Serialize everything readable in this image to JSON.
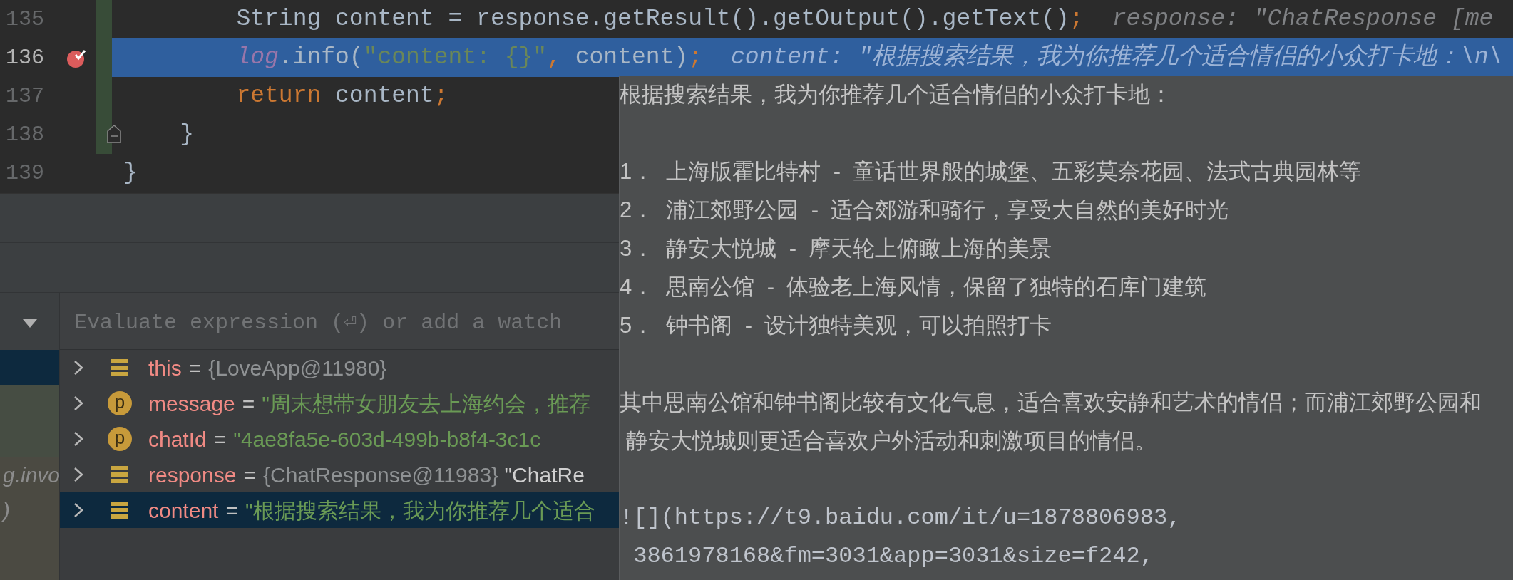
{
  "editor": {
    "lines": [
      {
        "number": "135",
        "breakpoint": false,
        "current": false,
        "changed": true,
        "fold_marker": false,
        "tokens": [
          {
            "kind": "plain",
            "text": "        String content = response.getResult().getOutput().getText()"
          },
          {
            "kind": "keyword",
            "text": ";"
          }
        ],
        "hint": "response: \"ChatResponse [me"
      },
      {
        "number": "136",
        "breakpoint": true,
        "current": true,
        "changed": true,
        "fold_marker": false,
        "tokens": [
          {
            "kind": "field",
            "text": "        log"
          },
          {
            "kind": "plain",
            "text": ".info("
          },
          {
            "kind": "string",
            "text": "\"content: {}\""
          },
          {
            "kind": "keyword",
            "text": ", "
          },
          {
            "kind": "plain",
            "text": "content)"
          },
          {
            "kind": "keyword",
            "text": ";"
          }
        ],
        "hint": "content: \"根据搜索结果，我为你推荐几个适合情侣的小众打卡地：\\n\\"
      },
      {
        "number": "137",
        "breakpoint": false,
        "current": false,
        "changed": true,
        "fold_marker": false,
        "tokens": [
          {
            "kind": "keyword",
            "text": "        return"
          },
          {
            "kind": "plain",
            "text": " content"
          },
          {
            "kind": "keyword",
            "text": ";"
          }
        ]
      },
      {
        "number": "138",
        "breakpoint": false,
        "current": false,
        "changed": true,
        "fold_marker": true,
        "tokens": [
          {
            "kind": "plain",
            "text": "    }"
          }
        ]
      },
      {
        "number": "139",
        "breakpoint": false,
        "current": false,
        "changed": false,
        "fold_marker": false,
        "tokens": [
          {
            "kind": "plain",
            "text": "}"
          }
        ]
      }
    ]
  },
  "frames": [
    {
      "selected": true
    },
    {
      "selected": false,
      "color": "#464d43"
    },
    {
      "selected": false,
      "color": "#464d43"
    },
    {
      "selected": false,
      "color": "#4b4a42",
      "text": "g.invo"
    },
    {
      "selected": false,
      "color": "#4b4a42",
      "text": ")"
    },
    {
      "selected": false,
      "color": "#4b4a42"
    },
    {
      "selected": false,
      "color": "#4b4a42"
    }
  ],
  "evaluate": {
    "placeholder": "Evaluate expression (⏎) or add a watch"
  },
  "variables": [
    {
      "kind": "field",
      "name": "this",
      "assign": "=",
      "selected": false,
      "value": [
        {
          "kind": "ref",
          "text": "{LoveApp@11980}"
        }
      ]
    },
    {
      "kind": "parameter",
      "badge": "p",
      "name": "message",
      "assign": "=",
      "selected": false,
      "value": [
        {
          "kind": "string",
          "text": "\"周末想带女朋友去上海约会，推荐"
        }
      ]
    },
    {
      "kind": "parameter",
      "badge": "p",
      "name": "chatId",
      "assign": "=",
      "selected": false,
      "value": [
        {
          "kind": "string",
          "text": "\"4ae8fa5e-603d-499b-b8f4-3c1c"
        }
      ]
    },
    {
      "kind": "field",
      "name": "response",
      "assign": "=",
      "selected": false,
      "value": [
        {
          "kind": "ref",
          "text": "{ChatResponse@11983}"
        },
        {
          "kind": "tostring",
          "text": " \"ChatRe"
        }
      ]
    },
    {
      "kind": "field",
      "name": "content",
      "assign": "=",
      "selected": true,
      "value": [
        {
          "kind": "string",
          "text": "\"根据搜索结果，我为你推荐几个适合"
        }
      ]
    }
  ],
  "tooltip": {
    "paragraphs": [
      {
        "kind": "text",
        "lines": [
          "根据搜索结果，我为你推荐几个适合情侣的小众打卡地："
        ]
      },
      {
        "kind": "text",
        "lines": [
          "1．  上海版霍比特村  -  童话世界般的城堡、五彩莫奈花园、法式古典园林等",
          "2．  浦江郊野公园  -  适合郊游和骑行，享受大自然的美好时光",
          "3．  静安大悦城  -  摩天轮上俯瞰上海的美景",
          "4．  思南公馆  -  体验老上海风情，保留了独特的石库门建筑",
          "5．  钟书阁  -  设计独特美观，可以拍照打卡"
        ]
      },
      {
        "kind": "text",
        "lines": [
          "其中思南公馆和钟书阁比较有文化气息，适合喜欢安静和艺术的情侣；而浦江郊野公园和",
          " 静安大悦城则更适合喜欢户外活动和刺激项目的情侣。"
        ]
      },
      {
        "kind": "code",
        "lines": [
          "![](https://t9.baidu.com/it/u=1878806983,",
          " 3861978168&fm=3031&app=3031&size=f242,"
        ]
      }
    ]
  }
}
